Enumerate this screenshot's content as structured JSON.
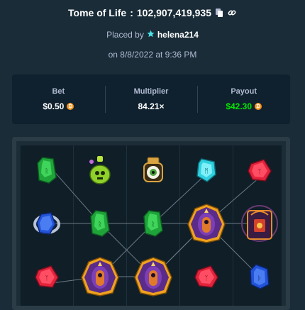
{
  "header": {
    "game_name": "Tome of Life",
    "bet_id": "102,907,419,935",
    "copy_icon": "copy-icon",
    "link_icon": "link-icon"
  },
  "placed": {
    "prefix": "Placed by",
    "username": "helena214",
    "user_icon": "star-icon"
  },
  "date": "on 8/8/2022 at 9:36 PM",
  "stats": {
    "bet": {
      "label": "Bet",
      "value": "$0.50"
    },
    "multiplier": {
      "label": "Multiplier",
      "value": "84.21×"
    },
    "payout": {
      "label": "Payout",
      "value": "$42.30"
    }
  },
  "colors": {
    "background": "#1a2c38",
    "panel": "#0f212e",
    "payout_green": "#00e701",
    "coin": "#f7931a"
  },
  "board": {
    "rows": [
      [
        "green-gem",
        "potion",
        "eyeball",
        "cyan-gem",
        "red-gem"
      ],
      [
        "blue-ring",
        "green-gem",
        "green-gem",
        "pharaoh-wild",
        "tome-book"
      ],
      [
        "red-gem",
        "pharaoh-wild",
        "pharaoh-wild",
        "red-gem",
        "blue-gem"
      ]
    ]
  }
}
